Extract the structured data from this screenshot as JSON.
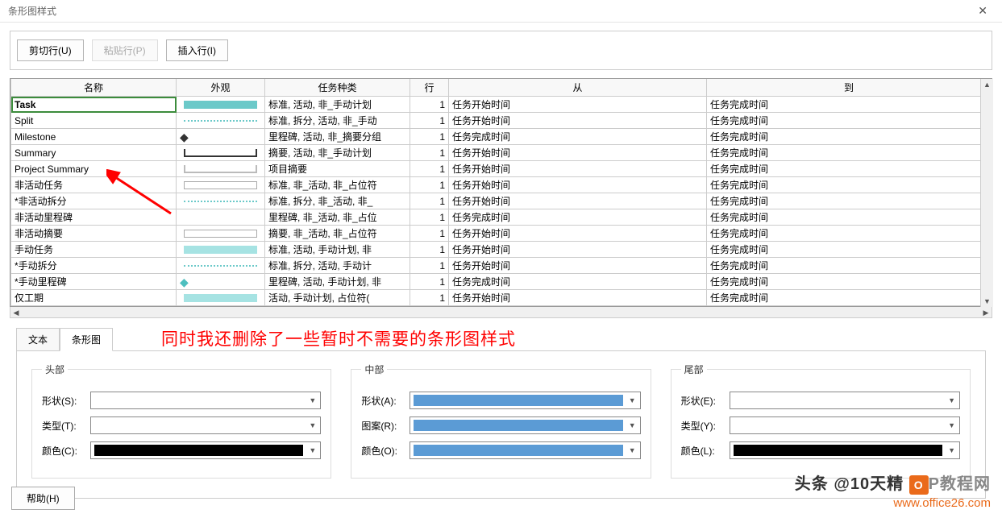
{
  "title": "条形图样式",
  "toolbar": {
    "cut": "剪切行(U)",
    "paste": "粘贴行(P)",
    "insert": "插入行(I)"
  },
  "columns": {
    "name": "名称",
    "appearance": "外观",
    "taskType": "任务种类",
    "row": "行",
    "from": "从",
    "to": "到"
  },
  "rows": [
    {
      "name": "Task",
      "style": "bar-solid",
      "task": "标准, 活动, 非_手动计划",
      "row": "1",
      "from": "任务开始时间",
      "to": "任务完成时间",
      "sel": true
    },
    {
      "name": "Split",
      "style": "bar-dotted",
      "task": "标准, 拆分, 活动, 非_手动",
      "row": "1",
      "from": "任务开始时间",
      "to": "任务完成时间"
    },
    {
      "name": "Milestone",
      "style": "bar-diamond",
      "task": "里程碑, 活动, 非_摘要分组",
      "row": "1",
      "from": "任务完成时间",
      "to": "任务完成时间"
    },
    {
      "name": "Summary",
      "style": "bar-bracket",
      "task": "摘要, 活动, 非_手动计划",
      "row": "1",
      "from": "任务开始时间",
      "to": "任务完成时间"
    },
    {
      "name": "Project Summary",
      "style": "bar-bracket-gray",
      "task": "项目摘要",
      "row": "1",
      "from": "任务开始时间",
      "to": "任务完成时间"
    },
    {
      "name": "非活动任务",
      "style": "bar-white",
      "task": "标准, 非_活动, 非_占位符",
      "row": "1",
      "from": "任务开始时间",
      "to": "任务完成时间"
    },
    {
      "name": "*非活动拆分",
      "style": "bar-dotted",
      "task": "标准, 拆分, 非_活动, 非_",
      "row": "1",
      "from": "任务开始时间",
      "to": "任务完成时间"
    },
    {
      "name": "非活动里程碑",
      "style": "",
      "task": "里程碑, 非_活动, 非_占位",
      "row": "1",
      "from": "任务完成时间",
      "to": "任务完成时间"
    },
    {
      "name": "非活动摘要",
      "style": "bar-white",
      "task": "摘要, 非_活动, 非_占位符",
      "row": "1",
      "from": "任务开始时间",
      "to": "任务完成时间"
    },
    {
      "name": "手动任务",
      "style": "bar-light",
      "task": "标准, 活动, 手动计划, 非",
      "row": "1",
      "from": "任务开始时间",
      "to": "任务完成时间"
    },
    {
      "name": "*手动拆分",
      "style": "bar-dotted",
      "task": "标准, 拆分, 活动, 手动计",
      "row": "1",
      "from": "任务开始时间",
      "to": "任务完成时间"
    },
    {
      "name": "*手动里程碑",
      "style": "bar-diamond-teal",
      "task": "里程碑, 活动, 手动计划, 非",
      "row": "1",
      "from": "任务完成时间",
      "to": "任务完成时间"
    },
    {
      "name": "仅工期",
      "style": "bar-light",
      "task": "活动, 手动计划, 占位符(",
      "row": "1",
      "from": "任务开始时间",
      "to": "任务完成时间"
    }
  ],
  "tabs": {
    "text": "文本",
    "bar": "条形图"
  },
  "annotation": "同时我还删除了一些暂时不需要的条形图样式",
  "groups": {
    "head": "头部",
    "mid": "中部",
    "tail": "尾部",
    "shape_s": "形状(S):",
    "type_t": "类型(T):",
    "color_c": "颜色(C):",
    "shape_a": "形状(A):",
    "pattern_r": "图案(R):",
    "color_o": "颜色(O):",
    "shape_e": "形状(E):",
    "type_y": "类型(Y):",
    "color_l": "颜色(L):"
  },
  "footer": {
    "help": "帮助(H)",
    "wm1a": "头条 @10天精",
    "wm1b": "P",
    "wm1c": "教程网",
    "wm2": "www.office26.com"
  }
}
